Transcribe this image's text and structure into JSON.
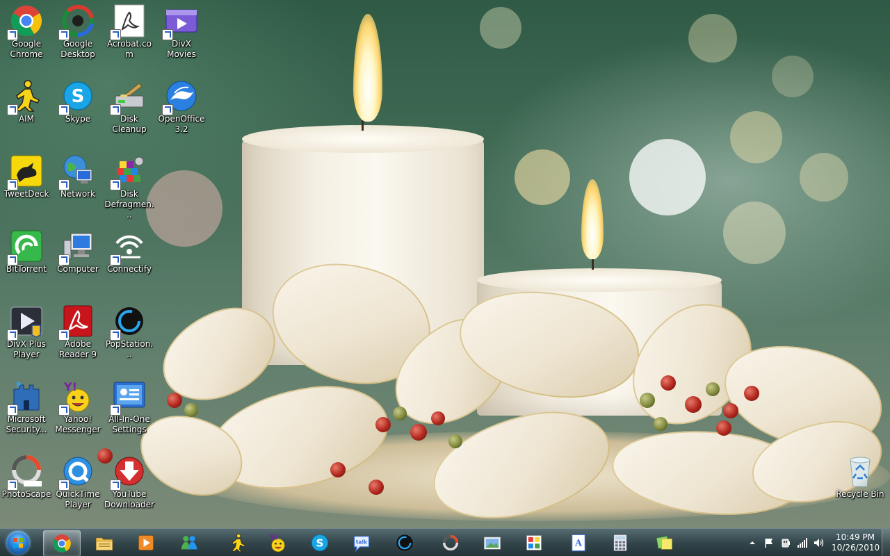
{
  "desktop": {
    "icons": [
      {
        "label": "Google Chrome",
        "icon": "chrome-icon"
      },
      {
        "label": "Google Desktop",
        "icon": "google-desktop-icon"
      },
      {
        "label": "Acrobat.com",
        "icon": "acrobat-com-icon"
      },
      {
        "label": "DivX Movies",
        "icon": "divx-movies-icon"
      },
      {
        "label": "AIM",
        "icon": "aim-icon"
      },
      {
        "label": "Skype",
        "icon": "skype-icon"
      },
      {
        "label": "Disk Cleanup",
        "icon": "disk-cleanup-icon"
      },
      {
        "label": "OpenOffice 3.2",
        "icon": "openoffice-icon"
      },
      {
        "label": "TweetDeck",
        "icon": "tweetdeck-icon"
      },
      {
        "label": "Network",
        "icon": "network-icon"
      },
      {
        "label": "Disk Defragmen...",
        "icon": "disk-defragmenter-icon"
      },
      {
        "label": "BitTorrent",
        "icon": "bittorrent-icon"
      },
      {
        "label": "Computer",
        "icon": "computer-icon"
      },
      {
        "label": "Connectify",
        "icon": "connectify-icon"
      },
      {
        "label": "DivX Plus Player",
        "icon": "divx-player-icon"
      },
      {
        "label": "Adobe Reader 9",
        "icon": "adobe-reader-icon"
      },
      {
        "label": "PopStation...",
        "icon": "popstation-icon"
      },
      {
        "label": "Microsoft Security...",
        "icon": "microsoft-security-icon"
      },
      {
        "label": "Yahoo! Messenger",
        "icon": "yahoo-messenger-icon"
      },
      {
        "label": "All-In-One Settings",
        "icon": "all-in-one-settings-icon"
      },
      {
        "label": "PhotoScape",
        "icon": "photoscape-icon"
      },
      {
        "label": "QuickTime Player",
        "icon": "quicktime-icon"
      },
      {
        "label": "YouTube Downloader",
        "icon": "youtube-downloader-icon"
      },
      {
        "label": "Recycle Bin",
        "icon": "recycle-bin-icon"
      }
    ]
  },
  "taskbar": {
    "start": {
      "icon": "windows-start-orb-icon"
    },
    "pinned": [
      {
        "icon": "chrome-icon",
        "active": true
      },
      {
        "icon": "windows-explorer-icon",
        "active": false
      },
      {
        "icon": "media-player-icon",
        "active": false
      },
      {
        "icon": "messenger-icon",
        "active": false
      },
      {
        "icon": "aim-icon",
        "active": false
      },
      {
        "icon": "yahoo-messenger-icon",
        "active": false
      },
      {
        "icon": "skype-icon",
        "active": false
      },
      {
        "icon": "google-talk-icon",
        "active": false
      },
      {
        "icon": "popstation-icon",
        "active": false
      },
      {
        "icon": "photoscape-icon",
        "active": false
      },
      {
        "icon": "photo-viewer-icon",
        "active": false
      },
      {
        "icon": "paint-icon",
        "active": false
      },
      {
        "icon": "wordpad-icon",
        "active": false
      },
      {
        "icon": "calculator-icon",
        "active": false
      },
      {
        "icon": "sticky-notes-icon",
        "active": false
      }
    ],
    "tray": {
      "icons": [
        "show-hidden-icons-chevron-icon",
        "action-center-flag-icon",
        "power-plug-icon",
        "wifi-signal-icon",
        "volume-icon"
      ],
      "time": "10:49 PM",
      "date": "10/26/2010"
    }
  }
}
